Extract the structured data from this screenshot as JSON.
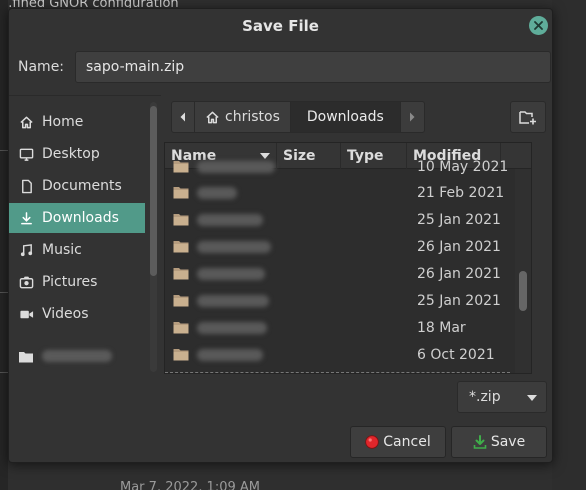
{
  "background": {
    "top_text": "...fined GNOR configuration",
    "bottom_text": "Mar 7, 2022, 1:09 AM"
  },
  "dialog": {
    "title": "Save File",
    "name_label": "Name:",
    "name_value": "sapo-main.zip",
    "accent_color": "#519a89"
  },
  "sidebar": {
    "items": [
      {
        "label": "Home",
        "icon": "home-icon"
      },
      {
        "label": "Desktop",
        "icon": "desktop-icon"
      },
      {
        "label": "Documents",
        "icon": "document-icon"
      },
      {
        "label": "Downloads",
        "icon": "download-icon",
        "active": true
      },
      {
        "label": "Music",
        "icon": "music-icon"
      },
      {
        "label": "Pictures",
        "icon": "camera-icon"
      },
      {
        "label": "Videos",
        "icon": "video-icon"
      },
      {
        "label": "",
        "icon": "folder-icon"
      }
    ]
  },
  "pathbar": {
    "home_segment": "christos",
    "current_segment": "Downloads"
  },
  "filelist": {
    "headers": {
      "name": "Name",
      "size": "Size",
      "type": "Type",
      "modified": "Modified"
    },
    "rows": [
      {
        "modified": "10 May 2021"
      },
      {
        "modified": "21 Feb 2021"
      },
      {
        "modified": "25 Jan 2021"
      },
      {
        "modified": "26 Jan 2021"
      },
      {
        "modified": "26 Jan 2021"
      },
      {
        "modified": "25 Jan 2021"
      },
      {
        "modified": "18 Mar"
      },
      {
        "modified": "6 Oct 2021"
      }
    ]
  },
  "filter": {
    "selected": "*.zip"
  },
  "buttons": {
    "cancel": "Cancel",
    "save": "Save"
  }
}
